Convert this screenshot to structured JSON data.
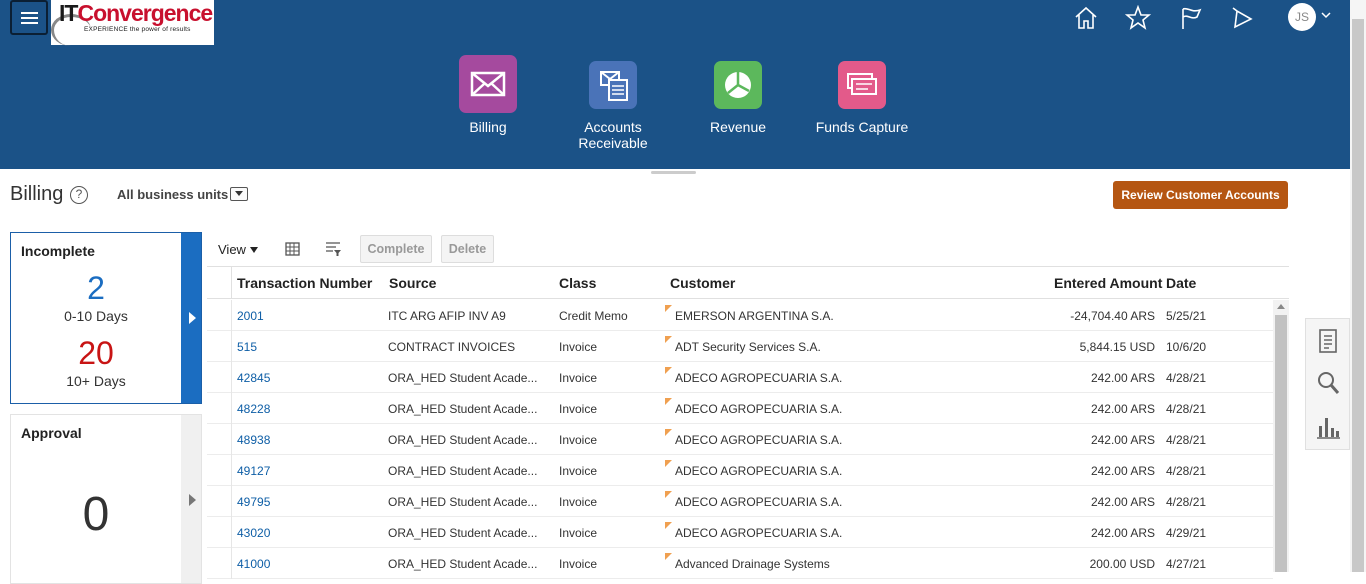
{
  "app": {
    "logo_text_1": "IT",
    "logo_text_2": "Convergence",
    "logo_tagline": "EXPERIENCE the power of results",
    "user_initials": "JS"
  },
  "header_icons": [
    "home-icon",
    "favorites-star-icon",
    "watchlist-flag-icon",
    "notifications-bell-icon"
  ],
  "tiles": [
    {
      "label": "Billing",
      "color": "#a54a9e",
      "icon": "envelope-icon"
    },
    {
      "label": "Accounts Receivable",
      "color": "#4a73b8",
      "icon": "envelope-document-icon"
    },
    {
      "label": "Revenue",
      "color": "#5cb85c",
      "icon": "pie-chart-icon"
    },
    {
      "label": "Funds Capture",
      "color": "#e35a8a",
      "icon": "checks-icon"
    }
  ],
  "page": {
    "title": "Billing",
    "help": "?",
    "business_unit": "All business units",
    "review_button": "Review Customer Accounts"
  },
  "cards": {
    "incomplete": {
      "title": "Incomplete",
      "count1": "2",
      "range1": "0-10 Days",
      "count2": "20",
      "range2": "10+ Days"
    },
    "approval": {
      "title": "Approval",
      "count": "0"
    }
  },
  "toolbar": {
    "view_label": "View",
    "complete_label": "Complete",
    "delete_label": "Delete"
  },
  "table": {
    "columns": [
      "Transaction Number",
      "Source",
      "Class",
      "Customer",
      "Entered Amount",
      "Date"
    ],
    "rows": [
      {
        "number": "2001",
        "source": "ITC ARG AFIP INV A9",
        "class": "Credit Memo",
        "customer": "EMERSON ARGENTINA S.A.",
        "amount": "-24,704.40 ARS",
        "date": "5/25/21"
      },
      {
        "number": "515",
        "source": "CONTRACT INVOICES",
        "class": "Invoice",
        "customer": "ADT Security Services S.A.",
        "amount": "5,844.15 USD",
        "date": "10/6/20"
      },
      {
        "number": "42845",
        "source": "ORA_HED Student Acade...",
        "class": "Invoice",
        "customer": "ADECO AGROPECUARIA S.A.",
        "amount": "242.00 ARS",
        "date": "4/28/21"
      },
      {
        "number": "48228",
        "source": "ORA_HED Student Acade...",
        "class": "Invoice",
        "customer": "ADECO AGROPECUARIA S.A.",
        "amount": "242.00 ARS",
        "date": "4/28/21"
      },
      {
        "number": "48938",
        "source": "ORA_HED Student Acade...",
        "class": "Invoice",
        "customer": "ADECO AGROPECUARIA S.A.",
        "amount": "242.00 ARS",
        "date": "4/28/21"
      },
      {
        "number": "49127",
        "source": "ORA_HED Student Acade...",
        "class": "Invoice",
        "customer": "ADECO AGROPECUARIA S.A.",
        "amount": "242.00 ARS",
        "date": "4/28/21"
      },
      {
        "number": "49795",
        "source": "ORA_HED Student Acade...",
        "class": "Invoice",
        "customer": "ADECO AGROPECUARIA S.A.",
        "amount": "242.00 ARS",
        "date": "4/28/21"
      },
      {
        "number": "43020",
        "source": "ORA_HED Student Acade...",
        "class": "Invoice",
        "customer": "ADECO AGROPECUARIA S.A.",
        "amount": "242.00 ARS",
        "date": "4/29/21"
      },
      {
        "number": "41000",
        "source": "ORA_HED Student Acade...",
        "class": "Invoice",
        "customer": "Advanced Drainage Systems",
        "amount": "200.00 USD",
        "date": "4/27/21"
      }
    ]
  },
  "side_panel_icons": [
    "document-icon",
    "search-icon",
    "bar-chart-icon"
  ]
}
